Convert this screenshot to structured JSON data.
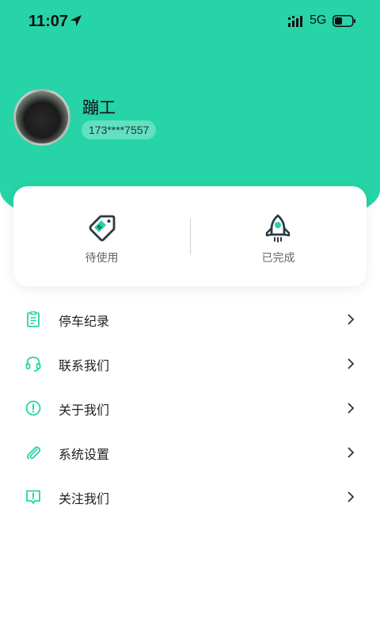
{
  "status_bar": {
    "time": "11:07",
    "network": "5G"
  },
  "profile": {
    "username": "蹦工",
    "phone": "173****7557"
  },
  "orders": [
    {
      "label": "待使用",
      "icon": "coupon-tag-icon"
    },
    {
      "label": "已完成",
      "icon": "rocket-icon"
    }
  ],
  "menu": [
    {
      "label": "停车纪录",
      "icon": "clipboard-list-icon"
    },
    {
      "label": "联系我们",
      "icon": "headset-icon"
    },
    {
      "label": "关于我们",
      "icon": "info-circle-icon"
    },
    {
      "label": "系统设置",
      "icon": "paperclip-icon"
    },
    {
      "label": "关注我们",
      "icon": "feedback-bubble-icon"
    }
  ],
  "colors": {
    "accent": "#26d4a7",
    "icon_dark": "#2b3a42"
  }
}
